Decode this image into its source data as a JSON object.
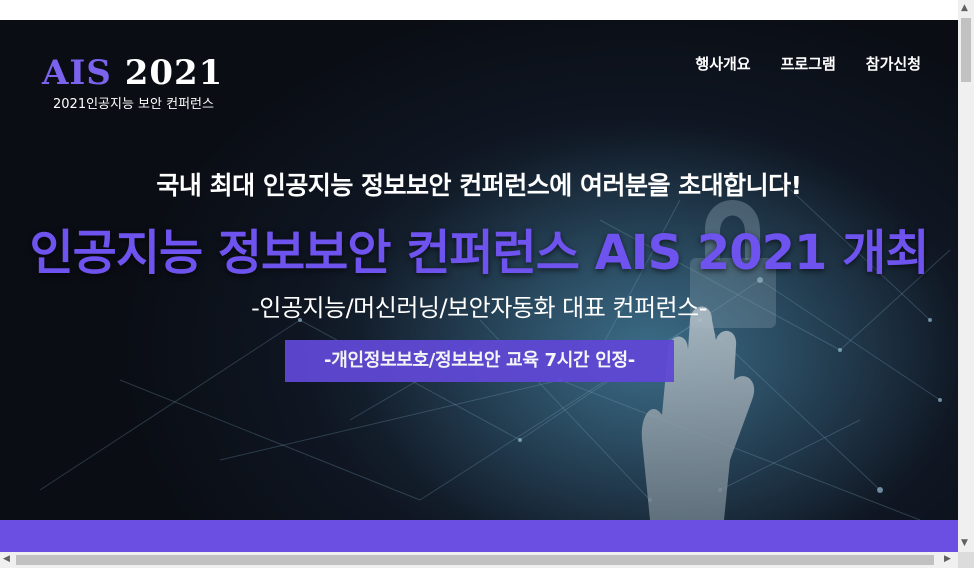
{
  "logo": {
    "brand": "AIS",
    "year": "2021",
    "subtitle": "2021인공지능 보안 컨퍼런스"
  },
  "nav": {
    "items": [
      "행사개요",
      "프로그램",
      "참가신청"
    ]
  },
  "hero": {
    "line1": "국내 최대 인공지능 정보보안 컨퍼런스에 여러분을 초대합니다!",
    "line2": "인공지능 정보보안 컨퍼런스 AIS 2021 개최",
    "line3": "-인공지능/머신러닝/보안자동화 대표 컨퍼런스-",
    "badge": "-개인정보보호/정보보안 교육 7시간 인정-"
  },
  "colors": {
    "accent": "#6b4fe3",
    "brand_text": "#7b63ee",
    "hero_bg": "#0f1622"
  },
  "scrollbars": {
    "up": "▲",
    "down": "▼",
    "left": "◀",
    "right": "▶"
  }
}
